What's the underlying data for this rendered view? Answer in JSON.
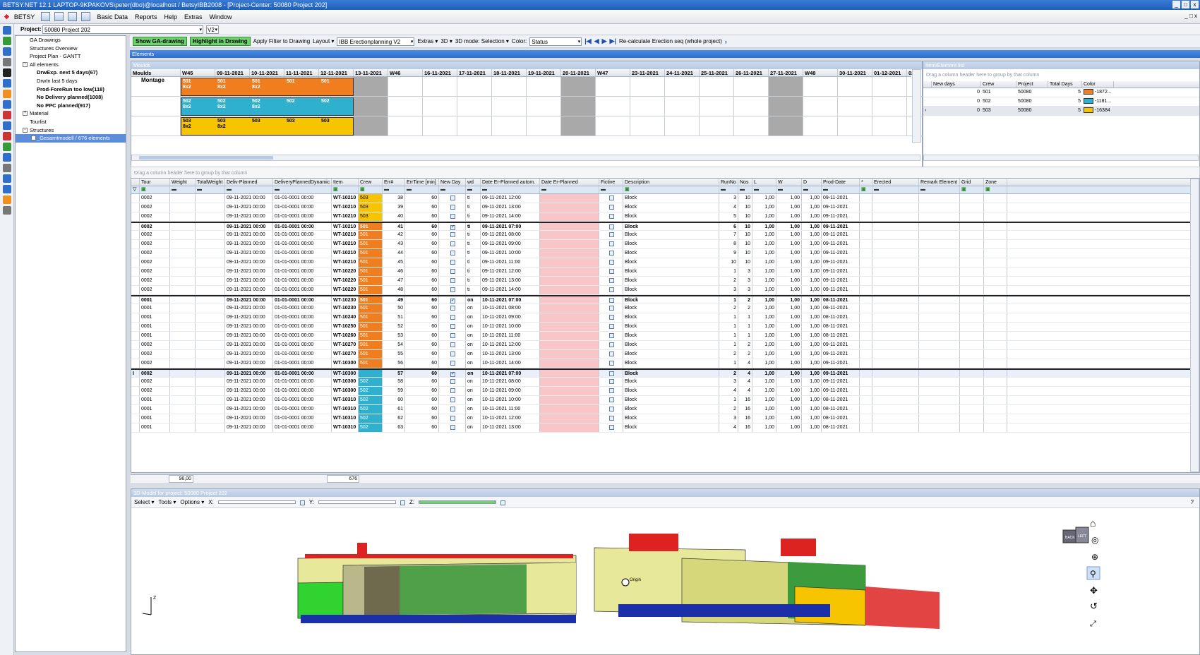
{
  "window": {
    "title": "BETSY.NET 12.1  LAPTOP-9KPAKOVS\\peter(dbo)@localhost / BetsyIBB2008 - [Project-Center: 50080 Project 202]"
  },
  "menu": {
    "app": "BETSY",
    "items": [
      "Basic Data",
      "Reports",
      "Help",
      "Extras",
      "Window"
    ]
  },
  "project": {
    "label": "Project:",
    "value": "50080 Project 202",
    "version": "V2"
  },
  "tree": [
    {
      "label": "GA Drawings",
      "indent": 1,
      "bold": false
    },
    {
      "label": "Structures Overview",
      "indent": 1,
      "bold": false
    },
    {
      "label": "Project Plan - GANTT",
      "indent": 1,
      "bold": false
    },
    {
      "label": "All elements",
      "indent": 1,
      "bold": false,
      "expander": "-"
    },
    {
      "label": "DrwExp. next 5 days(67)",
      "indent": 2,
      "bold": true
    },
    {
      "label": "DrwIn last 5 days",
      "indent": 2,
      "bold": false
    },
    {
      "label": "Prod-ForeRun too low(118)",
      "indent": 2,
      "bold": true
    },
    {
      "label": "No Delivery planned(1008)",
      "indent": 2,
      "bold": true
    },
    {
      "label": "No PPC planned(917)",
      "indent": 2,
      "bold": true
    },
    {
      "label": "Material",
      "indent": 1,
      "bold": false,
      "expander": "+"
    },
    {
      "label": "Tourlist",
      "indent": 1,
      "bold": false
    },
    {
      "label": "Structures",
      "indent": 1,
      "bold": false,
      "expander": "-"
    },
    {
      "label": "_Gesamtmodell / 676 elements",
      "indent": 2,
      "bold": false,
      "selected": true,
      "expander": "+"
    }
  ],
  "toolbar": {
    "show_ga": "Show GA-drawing",
    "highlight": "Highlight in Drawing",
    "apply_filter": "Apply Filter to Drawing",
    "layout": "Layout",
    "layout_value": "IBB Erectionplanning V2",
    "extras": "Extras",
    "threeD": "3D",
    "mode": "3D mode: Selection",
    "color_label": "Color:",
    "color_value": "Status",
    "recalc": "Re-calculate Erection seq (whole project)"
  },
  "elements_title": "Elements",
  "moulds": {
    "title": "Moulds",
    "first_col": "Moulds",
    "columns": [
      "W45",
      "09-11-2021",
      "10-11-2021",
      "11-11-2021",
      "12-11-2021",
      "13-11-2021",
      "W46",
      "16-11-2021",
      "17-11-2021",
      "18-11-2021",
      "19-11-2021",
      "20-11-2021",
      "W47",
      "23-11-2021",
      "24-11-2021",
      "25-11-2021",
      "26-11-2021",
      "27-11-2021",
      "W48",
      "30-11-2021",
      "01-12-2021",
      "02-1"
    ],
    "row_label": "Montage",
    "bars": [
      {
        "crew": "501",
        "color": "#f07d1e",
        "cells": [
          [
            "501",
            "8x2"
          ],
          [
            "501",
            "8x2"
          ],
          [
            "501",
            "8x2"
          ],
          [
            "501",
            ""
          ],
          [
            "501",
            ""
          ]
        ]
      },
      {
        "crew": "502",
        "color": "#2fb0cf",
        "cells": [
          [
            "502",
            "8x2"
          ],
          [
            "502",
            "8x2"
          ],
          [
            "502",
            "8x2"
          ],
          [
            "502",
            ""
          ],
          [
            "502",
            ""
          ]
        ]
      },
      {
        "crew": "503",
        "color": "#f6c500",
        "cells": [
          [
            "503",
            "8x2"
          ],
          [
            "503",
            "8x2"
          ],
          [
            "503",
            ""
          ],
          [
            "503",
            ""
          ],
          [
            "503",
            ""
          ]
        ]
      }
    ]
  },
  "itemlist": {
    "title": "Item/Element list",
    "hint": "Drag a column header here to group by that column",
    "headers": [
      "New days",
      "Crew",
      "Project",
      "Total Days",
      "Color"
    ],
    "rows": [
      {
        "new_days": "0",
        "crew": "501",
        "project": "50080",
        "total": "5",
        "color": "#f07d1e",
        "color_val": "-1872..."
      },
      {
        "new_days": "0",
        "crew": "502",
        "project": "50080",
        "total": "5",
        "color": "#2fb0cf",
        "color_val": "-1181..."
      },
      {
        "new_days": "0",
        "crew": "503",
        "project": "50080",
        "total": "5",
        "color": "#f6c500",
        "color_val": "-16384"
      }
    ]
  },
  "grid": {
    "hint": "Drag a column header here to group by that column",
    "headers": [
      "Tour",
      "Weight",
      "TotalWeight",
      "Deliv-Planned",
      "DeliveryPlannedDynamic",
      "Item",
      "Crew",
      "Err#",
      "ErrTime [min]",
      "New Day",
      "wd",
      "Date Er-Planned autom.",
      "Date Er-Planned",
      "Fictive",
      "Description",
      "RunNo",
      "Nos",
      "L",
      "W",
      "D",
      "Prod-Date",
      "*",
      "Erected",
      "Remark Element",
      "Grid",
      "Zone"
    ],
    "rows": [
      [
        "0002",
        "",
        "",
        "09-11-2021 00:00",
        "01-01-0001 00:00",
        "WT-10210",
        "503",
        "38",
        "60",
        "",
        "ti",
        "09-11-2021 12:00",
        "",
        "",
        "Block",
        "3",
        "10",
        "1,00",
        "1,00",
        "1,00",
        "09-11-2021"
      ],
      [
        "0002",
        "",
        "",
        "09-11-2021 00:00",
        "01-01-0001 00:00",
        "WT-10210",
        "503",
        "39",
        "60",
        "",
        "ti",
        "09-11-2021 13:00",
        "",
        "",
        "Block",
        "4",
        "10",
        "1,00",
        "1,00",
        "1,00",
        "09-11-2021"
      ],
      [
        "0002",
        "",
        "",
        "09-11-2021 00:00",
        "01-01-0001 00:00",
        "WT-10210",
        "503",
        "40",
        "60",
        "",
        "ti",
        "09-11-2021 14:00",
        "",
        "",
        "Block",
        "5",
        "10",
        "1,00",
        "1,00",
        "1,00",
        "09-11-2021"
      ],
      [
        "0002",
        "",
        "",
        "09-11-2021 00:00",
        "01-01-0001 00:00",
        "WT-10210",
        "501",
        "41",
        "60",
        "✓",
        "ti",
        "09-11-2021 07:00",
        "",
        "",
        "Block",
        "6",
        "10",
        "1,00",
        "1,00",
        "1,00",
        "09-11-2021"
      ],
      [
        "0002",
        "",
        "",
        "09-11-2021 00:00",
        "01-01-0001 00:00",
        "WT-10210",
        "501",
        "42",
        "60",
        "",
        "ti",
        "09-11-2021 08:00",
        "",
        "",
        "Block",
        "7",
        "10",
        "1,00",
        "1,00",
        "1,00",
        "09-11-2021"
      ],
      [
        "0002",
        "",
        "",
        "09-11-2021 00:00",
        "01-01-0001 00:00",
        "WT-10210",
        "501",
        "43",
        "60",
        "",
        "ti",
        "09-11-2021 09:00",
        "",
        "",
        "Block",
        "8",
        "10",
        "1,00",
        "1,00",
        "1,00",
        "09-11-2021"
      ],
      [
        "0002",
        "",
        "",
        "09-11-2021 00:00",
        "01-01-0001 00:00",
        "WT-10210",
        "501",
        "44",
        "60",
        "",
        "ti",
        "09-11-2021 10:00",
        "",
        "",
        "Block",
        "9",
        "10",
        "1,00",
        "1,00",
        "1,00",
        "09-11-2021"
      ],
      [
        "0002",
        "",
        "",
        "09-11-2021 00:00",
        "01-01-0001 00:00",
        "WT-10210",
        "501",
        "45",
        "60",
        "",
        "ti",
        "09-11-2021 11:00",
        "",
        "",
        "Block",
        "10",
        "10",
        "1,00",
        "1,00",
        "1,00",
        "09-11-2021"
      ],
      [
        "0002",
        "",
        "",
        "09-11-2021 00:00",
        "01-01-0001 00:00",
        "WT-10220",
        "501",
        "46",
        "60",
        "",
        "ti",
        "09-11-2021 12:00",
        "",
        "",
        "Block",
        "1",
        "3",
        "1,00",
        "1,00",
        "1,00",
        "09-11-2021"
      ],
      [
        "0002",
        "",
        "",
        "09-11-2021 00:00",
        "01-01-0001 00:00",
        "WT-10220",
        "501",
        "47",
        "60",
        "",
        "ti",
        "09-11-2021 13:00",
        "",
        "",
        "Block",
        "2",
        "3",
        "1,00",
        "1,00",
        "1,00",
        "09-11-2021"
      ],
      [
        "0002",
        "",
        "",
        "09-11-2021 00:00",
        "01-01-0001 00:00",
        "WT-10220",
        "501",
        "48",
        "60",
        "",
        "ti",
        "09-11-2021 14:00",
        "",
        "",
        "Block",
        "3",
        "3",
        "1,00",
        "1,00",
        "1,00",
        "09-11-2021"
      ],
      [
        "0001",
        "",
        "",
        "09-11-2021 00:00",
        "01-01-0001 00:00",
        "WT-10230",
        "501",
        "49",
        "60",
        "✓",
        "on",
        "10-11-2021 07:00",
        "",
        "",
        "Block",
        "1",
        "2",
        "1,00",
        "1,00",
        "1,00",
        "08-11-2021"
      ],
      [
        "0001",
        "",
        "",
        "09-11-2021 00:00",
        "01-01-0001 00:00",
        "WT-10230",
        "501",
        "50",
        "60",
        "",
        "on",
        "10-11-2021 08:00",
        "",
        "",
        "Block",
        "2",
        "2",
        "1,00",
        "1,00",
        "1,00",
        "08-11-2021"
      ],
      [
        "0001",
        "",
        "",
        "09-11-2021 00:00",
        "01-01-0001 00:00",
        "WT-10240",
        "501",
        "51",
        "60",
        "",
        "on",
        "10-11-2021 09:00",
        "",
        "",
        "Block",
        "1",
        "1",
        "1,00",
        "1,00",
        "1,00",
        "08-11-2021"
      ],
      [
        "0001",
        "",
        "",
        "09-11-2021 00:00",
        "01-01-0001 00:00",
        "WT-10250",
        "501",
        "52",
        "60",
        "",
        "on",
        "10-11-2021 10:00",
        "",
        "",
        "Block",
        "1",
        "1",
        "1,00",
        "1,00",
        "1,00",
        "08-11-2021"
      ],
      [
        "0001",
        "",
        "",
        "09-11-2021 00:00",
        "01-01-0001 00:00",
        "WT-10260",
        "501",
        "53",
        "60",
        "",
        "on",
        "10-11-2021 11:00",
        "",
        "",
        "Block",
        "1",
        "1",
        "1,00",
        "1,00",
        "1,00",
        "08-11-2021"
      ],
      [
        "0002",
        "",
        "",
        "09-11-2021 00:00",
        "01-01-0001 00:00",
        "WT-10270",
        "501",
        "54",
        "60",
        "",
        "on",
        "10-11-2021 12:00",
        "",
        "",
        "Block",
        "1",
        "2",
        "1,00",
        "1,00",
        "1,00",
        "09-11-2021"
      ],
      [
        "0002",
        "",
        "",
        "09-11-2021 00:00",
        "01-01-0001 00:00",
        "WT-10270",
        "501",
        "55",
        "60",
        "",
        "on",
        "10-11-2021 13:00",
        "",
        "",
        "Block",
        "2",
        "2",
        "1,00",
        "1,00",
        "1,00",
        "09-11-2021"
      ],
      [
        "0002",
        "",
        "",
        "09-11-2021 00:00",
        "01-01-0001 00:00",
        "WT-10300",
        "501",
        "56",
        "60",
        "",
        "on",
        "10-11-2021 14:00",
        "",
        "",
        "Block",
        "1",
        "4",
        "1,00",
        "1,00",
        "1,00",
        "09-11-2021"
      ],
      [
        "0002",
        "",
        "",
        "09-11-2021 00:00",
        "01-01-0001 00:00",
        "WT-10300",
        "",
        "57",
        "60",
        "✓",
        "on",
        "10-11-2021 07:00",
        "",
        "",
        "Block",
        "2",
        "4",
        "1,00",
        "1,00",
        "1,00",
        "09-11-2021"
      ],
      [
        "0002",
        "",
        "",
        "09-11-2021 00:00",
        "01-01-0001 00:00",
        "WT-10300",
        "502",
        "58",
        "60",
        "",
        "on",
        "10-11-2021 08:00",
        "",
        "",
        "Block",
        "3",
        "4",
        "1,00",
        "1,00",
        "1,00",
        "09-11-2021"
      ],
      [
        "0002",
        "",
        "",
        "09-11-2021 00:00",
        "01-01-0001 00:00",
        "WT-10300",
        "502",
        "59",
        "60",
        "",
        "on",
        "10-11-2021 09:00",
        "",
        "",
        "Block",
        "4",
        "4",
        "1,00",
        "1,00",
        "1,00",
        "09-11-2021"
      ],
      [
        "0001",
        "",
        "",
        "09-11-2021 00:00",
        "01-01-0001 00:00",
        "WT-10310",
        "502",
        "60",
        "60",
        "",
        "on",
        "10-11-2021 10:00",
        "",
        "",
        "Block",
        "1",
        "16",
        "1,00",
        "1,00",
        "1,00",
        "08-11-2021"
      ],
      [
        "0001",
        "",
        "",
        "09-11-2021 00:00",
        "01-01-0001 00:00",
        "WT-10310",
        "502",
        "61",
        "60",
        "",
        "on",
        "10-11-2021 11:00",
        "",
        "",
        "Block",
        "2",
        "16",
        "1,00",
        "1,00",
        "1,00",
        "08-11-2021"
      ],
      [
        "0001",
        "",
        "",
        "09-11-2021 00:00",
        "01-01-0001 00:00",
        "WT-10310",
        "502",
        "62",
        "60",
        "",
        "on",
        "10-11-2021 12:00",
        "",
        "",
        "Block",
        "3",
        "16",
        "1,00",
        "1,00",
        "1,00",
        "08-11-2021"
      ],
      [
        "0001",
        "",
        "",
        "09-11-2021 00:00",
        "01-01-0001 00:00",
        "WT-10310",
        "502",
        "63",
        "60",
        "",
        "on",
        "10-11-2021 13:00",
        "",
        "",
        "Block",
        "4",
        "16",
        "1,00",
        "1,00",
        "1,00",
        "08-11-2021"
      ]
    ],
    "totals": {
      "weight": "96,00",
      "items": "676"
    }
  },
  "model": {
    "title": "3D-Model for project: 50080 Project 202",
    "select": "Select",
    "tools": "Tools",
    "options": "Options",
    "x": "X:",
    "y": "Y:",
    "z": "Z:",
    "help": "?",
    "origin": "Origin",
    "axis": "Z",
    "cube_left": "BACK",
    "cube_right": "LEFT"
  }
}
